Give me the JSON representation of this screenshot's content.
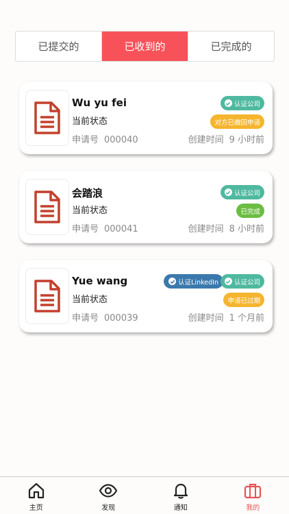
{
  "tabs": [
    {
      "label": "已提交的",
      "active": false
    },
    {
      "label": "已收到的",
      "active": true
    },
    {
      "label": "已完成的",
      "active": false
    }
  ],
  "labels": {
    "current_status": "当前状态",
    "application_no": "申请号",
    "created_time": "创建时间"
  },
  "cards": [
    {
      "name": "Wu yu fei",
      "application_no": "000040",
      "created": "9 小时前",
      "verified_badge": "认证公司",
      "status_badge": "对方已撤回申请",
      "status_color": "#f5b52e"
    },
    {
      "name": "会踏浪",
      "application_no": "000041",
      "created": "8 小时前",
      "verified_badge": "认证公司",
      "status_badge": "已完成",
      "status_color": "#6cbd43"
    },
    {
      "name": "Yue wang",
      "application_no": "000039",
      "created": "1 个月前",
      "linkedin_badge": "认证LinkedIn",
      "verified_badge": "认证公司",
      "status_badge": "申请已过期",
      "status_color": "#f5b52e"
    }
  ],
  "nav": [
    {
      "label": "主页",
      "icon": "home-icon"
    },
    {
      "label": "发现",
      "icon": "eye-icon"
    },
    {
      "label": "通知",
      "icon": "bell-icon"
    },
    {
      "label": "我的",
      "icon": "briefcase-icon",
      "active": true
    }
  ],
  "colors": {
    "accent": "#f7525a",
    "verified": "#4fb9a0",
    "linkedin": "#3b79ad",
    "doc_icon": "#c2402e"
  }
}
